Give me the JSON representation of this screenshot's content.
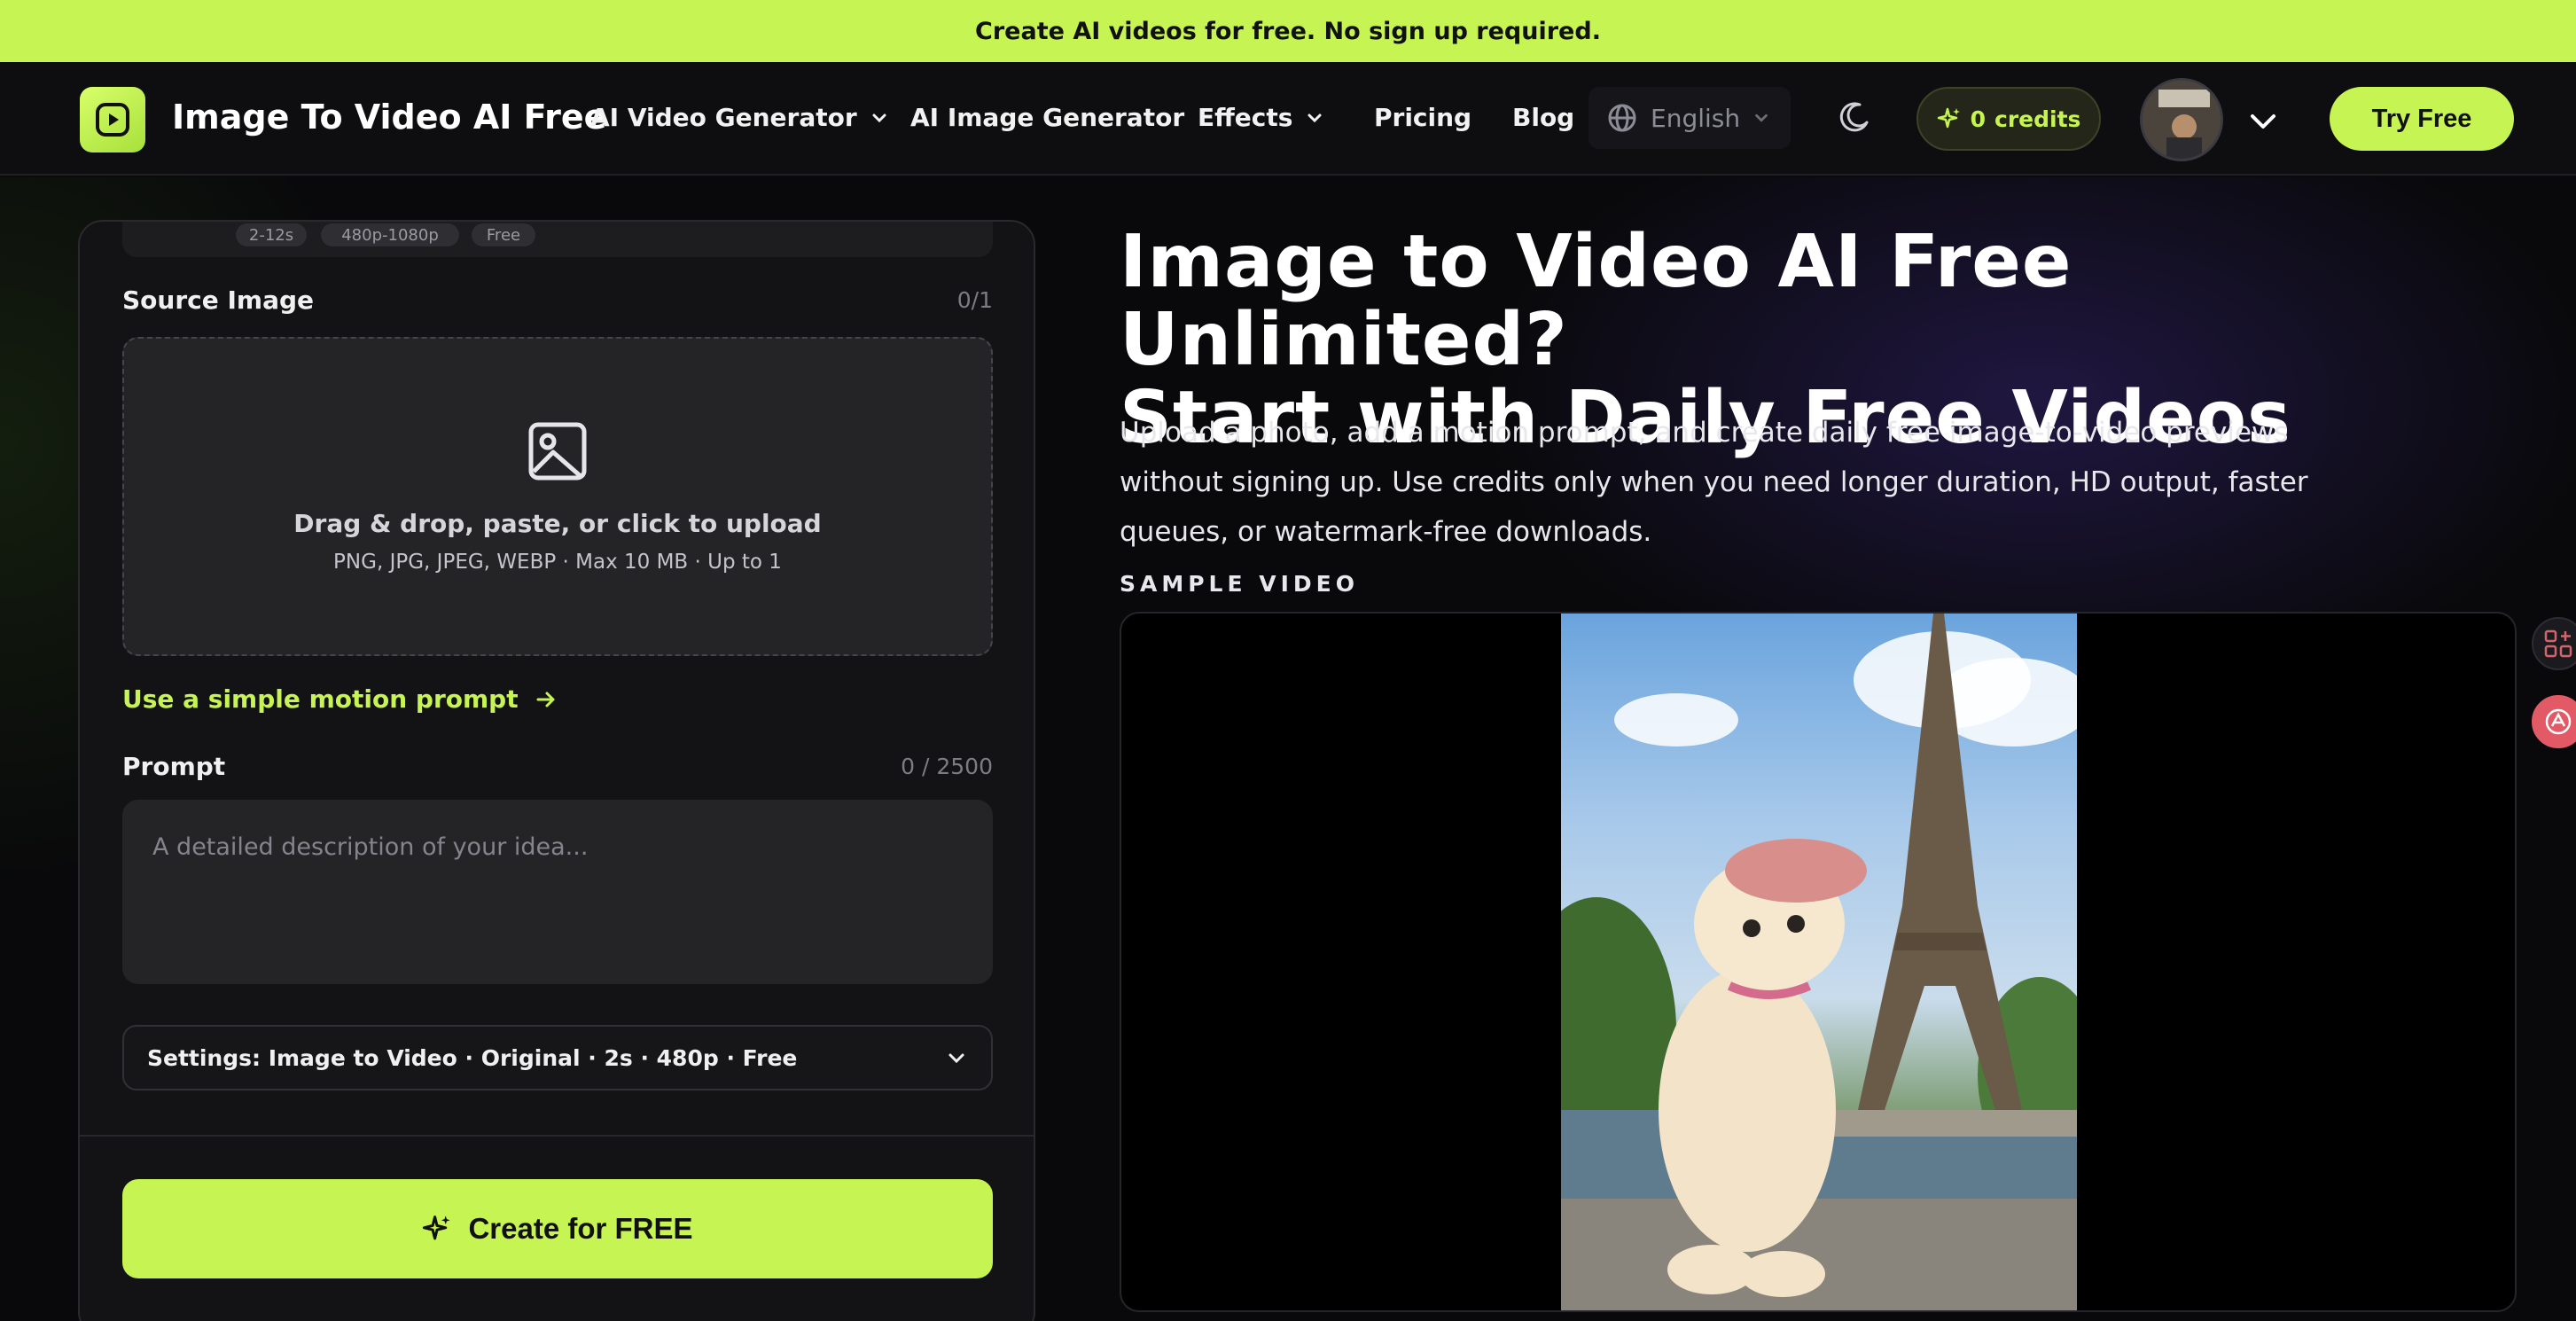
{
  "banner": {
    "text": "Create AI videos for free. No sign up required."
  },
  "nav": {
    "logo_text": "Image To Video AI Free",
    "items": [
      {
        "label": "AI Video Generator",
        "has_dropdown": true
      },
      {
        "label": "AI Image Generator",
        "has_dropdown": false
      },
      {
        "label": "Effects",
        "has_dropdown": true
      },
      {
        "label": "Pricing",
        "has_dropdown": false
      },
      {
        "label": "Blog",
        "has_dropdown": false
      }
    ],
    "language": "English",
    "credits_count": "0",
    "credits_label": "credits",
    "try_free": "Try Free"
  },
  "panel": {
    "chips": [
      "2-12s",
      "480p-1080p",
      "Free"
    ],
    "source_image_label": "Source Image",
    "source_image_count": "0/1",
    "dropzone_title": "Drag & drop, paste, or click to upload",
    "dropzone_sub": "PNG, JPG, JPEG, WEBP · Max 10 MB · Up to 1",
    "motion_link": "Use a simple motion prompt",
    "prompt_label": "Prompt",
    "prompt_count": "0 / 2500",
    "prompt_placeholder": "A detailed description of your idea...",
    "settings_text": "Settings: Image to Video · Original · 2s · 480p · Free",
    "create_button": "Create for FREE"
  },
  "hero": {
    "title_line1": "Image to Video AI Free Unlimited?",
    "title_line2": "Start with Daily Free Videos",
    "description": "Upload a photo, add a motion prompt, and create daily free image-to-video previews without signing up. Use credits only when you need longer duration, HD output, faster queues, or watermark-free downloads.",
    "sample_label": "SAMPLE VIDEO"
  },
  "colors": {
    "accent": "#c6f452",
    "background": "#09090b",
    "panel": "#131315"
  }
}
